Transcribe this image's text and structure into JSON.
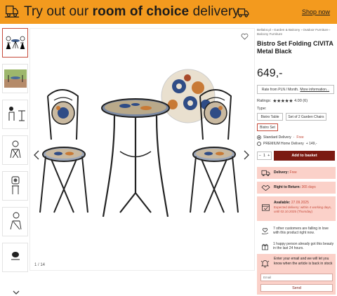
{
  "banner": {
    "promo_prefix": "Try out our ",
    "promo_bold": "room of choice",
    "promo_suffix": " delivery",
    "shop_now": "Shop now",
    "bg_color": "#f39a1e"
  },
  "gallery": {
    "counter": "1 / 14",
    "thumbnails": [
      {
        "icon": "bistro-set-icon",
        "active": true
      },
      {
        "icon": "bistro-outdoor-photo-icon",
        "active": false
      },
      {
        "icon": "bistro-set-dimensions-icon",
        "active": false
      },
      {
        "icon": "folding-chair-icon",
        "active": false
      },
      {
        "icon": "chair-dimensions-icon",
        "active": false
      },
      {
        "icon": "chair-detail-icon",
        "active": false
      },
      {
        "icon": "table-top-icon",
        "active": false
      }
    ]
  },
  "product": {
    "breadcrumb": "Bellalot.pl › Garden & Balcony › Outdoor Furniture › Balcony Furniture",
    "title": "Bistro Set Folding CIVITA Metal Black",
    "price": "649,-",
    "rate_text": "Rate from PLN / Month.",
    "rate_more": "More information...",
    "ratings_label": "Ratings:",
    "stars": "★★★★★",
    "rating_value": "4.00 (6)",
    "type_label": "Type:",
    "types": [
      {
        "label": "Bistro Table",
        "selected": false
      },
      {
        "label": "Set of 2 Garden Chairs",
        "selected": false
      },
      {
        "label": "Bistro Set",
        "selected": true
      }
    ],
    "delivery": [
      {
        "label": "Standard Delivery",
        "price": "Free",
        "selected": true
      },
      {
        "label": "PREMIUM Home Delivery",
        "price": "+ 149,-",
        "selected": false
      }
    ],
    "quantity": "1",
    "qty_minus": "−",
    "qty_plus": "+",
    "add_to_basket": "Add to basket"
  },
  "perks": {
    "delivery_label": "Delivery:",
    "delivery_value": "Free",
    "return_label": "Right to Return:",
    "return_value": "365 days",
    "available_label": "Available:",
    "available_date": "27.09.2025",
    "expected_text": "Expected delivery: within 4 working days, until 02.10.2025 (Thursday)",
    "in_love_text": "7 other customers are falling in love with this product right now.",
    "happy_text": "1 happy person already got this beauty in the last 24 hours."
  },
  "notify": {
    "text": "Enter your email and we will let you know when the article is back in stock",
    "email_placeholder": "Email",
    "send_label": "Send"
  },
  "colors": {
    "accent": "#c54a3a",
    "button": "#7b1a12",
    "pink_box": "#fbd1c9"
  }
}
